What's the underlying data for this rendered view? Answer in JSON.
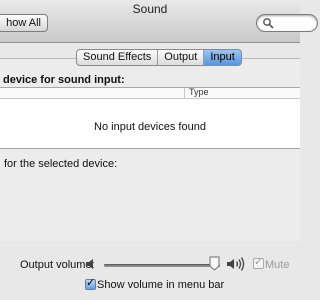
{
  "window": {
    "title": "Sound"
  },
  "toolbar": {
    "show_all_label": "how All",
    "search_placeholder": ""
  },
  "tabs": [
    {
      "label": "Sound Effects",
      "selected": false
    },
    {
      "label": "Output",
      "selected": false
    },
    {
      "label": "Input",
      "selected": true
    }
  ],
  "input": {
    "heading": "device for sound input:",
    "columns": [
      "",
      "Type"
    ],
    "empty_message": "No input devices found",
    "settings_label": "for the selected device:"
  },
  "footer": {
    "output_volume_label": "Output volume:",
    "output_volume_level": 0.92,
    "mute_label": "Mute",
    "mute_checked": true,
    "mute_enabled": false,
    "show_volume_label": "Show volume in menu bar",
    "show_volume_checked": true
  },
  "icons": {
    "search": "search-icon",
    "speaker_low": "speaker-low-icon",
    "speaker_high": "speaker-high-icon"
  },
  "colors": {
    "accent": "#5b95dd"
  }
}
